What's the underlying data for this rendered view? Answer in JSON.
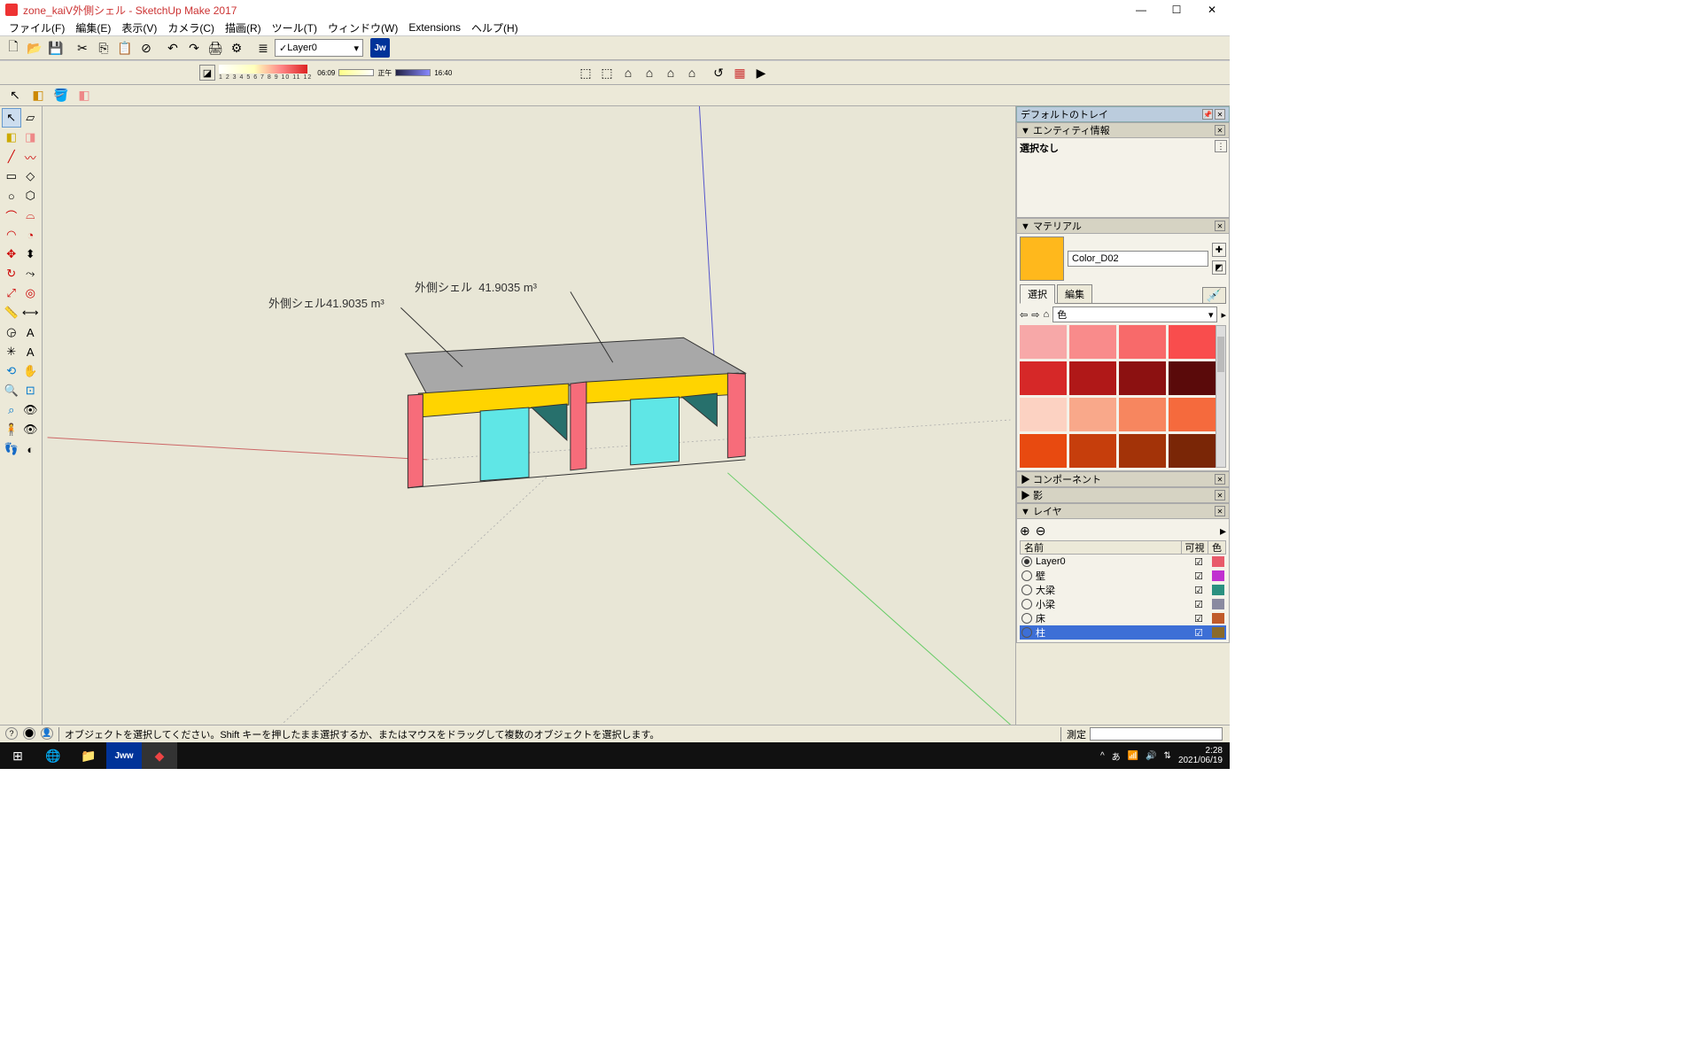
{
  "titlebar": {
    "title": "zone_kaiV外側シェル - SketchUp Make 2017"
  },
  "menu": [
    "ファイル(F)",
    "編集(E)",
    "表示(V)",
    "カメラ(C)",
    "描画(R)",
    "ツール(T)",
    "ウィンドウ(W)",
    "Extensions",
    "ヘルプ(H)"
  ],
  "layer_combo": "Layer0",
  "jw": "Jw",
  "annot": {
    "a1": "外側シェル41.9035 m³",
    "a2_label": "外側シェル",
    "a2_val": "41.9035 m³"
  },
  "labels_ruler_left": "06:09",
  "labels_ruler_mid": "正午",
  "labels_ruler_right": "16:40",
  "ruler_nums": "1 2 3 4 5 6 7 8 9 10 11 12",
  "tray": {
    "title": "デフォルトのトレイ",
    "entity": {
      "hdr": "▼ エンティティ情報",
      "none": "選択なし"
    },
    "material": {
      "hdr": "▼ マテリアル",
      "name": "Color_D02",
      "tab_sel": "選択",
      "tab_edit": "編集",
      "combo": "色",
      "swatches": [
        "#f7a8a8",
        "#f98b8b",
        "#f86a6a",
        "#f94d4d",
        "#d62828",
        "#b01818",
        "#8c1111",
        "#5a0a0a",
        "#fcd2c2",
        "#f9a88a",
        "#f7865f",
        "#f56a3d",
        "#e84a10",
        "#c63e0c",
        "#a33308",
        "#7a2606"
      ]
    },
    "component": "▶ コンポーネント",
    "shadow": "▶ 影",
    "layer": {
      "hdr": "▼ レイヤ",
      "cols": {
        "name": "名前",
        "vis": "可視",
        "col": "色"
      },
      "rows": [
        {
          "n": "Layer0",
          "on": true,
          "sel": false,
          "c": "#e85a6a"
        },
        {
          "n": "壁",
          "on": false,
          "sel": false,
          "c": "#c030d0"
        },
        {
          "n": "大梁",
          "on": false,
          "sel": false,
          "c": "#2a9080"
        },
        {
          "n": "小梁",
          "on": false,
          "sel": false,
          "c": "#8a8aa0"
        },
        {
          "n": "床",
          "on": false,
          "sel": false,
          "c": "#c05a2a"
        },
        {
          "n": "柱",
          "on": false,
          "sel": true,
          "c": "#8a6a2a"
        }
      ]
    }
  },
  "status": {
    "hint": "オブジェクトを選択してください。Shift キーを押したまま選択するか、またはマウスをドラッグして複数のオブジェクトを選択します。",
    "measure_label": "測定"
  },
  "taskbar": {
    "time": "2:28",
    "date": "2021/06/19"
  }
}
